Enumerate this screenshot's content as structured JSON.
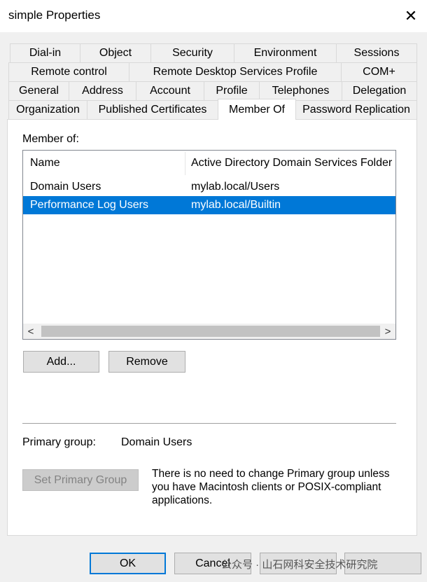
{
  "window": {
    "title": "simple Properties",
    "close_glyph": "✕"
  },
  "tabs": {
    "row1": [
      "Dial-in",
      "Object",
      "Security",
      "Environment",
      "Sessions"
    ],
    "row2": [
      "Remote control",
      "Remote Desktop Services Profile",
      "COM+"
    ],
    "row3": [
      "General",
      "Address",
      "Account",
      "Profile",
      "Telephones",
      "Delegation"
    ],
    "row4": [
      "Organization",
      "Published Certificates",
      "Member Of",
      "Password Replication"
    ],
    "active": "Member Of"
  },
  "member_of": {
    "label": "Member of:",
    "columns": [
      "Name",
      "Active Directory Domain Services Folder"
    ],
    "rows": [
      {
        "name": "Domain Users",
        "folder": "mylab.local/Users",
        "selected": false
      },
      {
        "name": "Performance Log Users",
        "folder": "mylab.local/Builtin",
        "selected": true
      }
    ],
    "scroll_left": "<",
    "scroll_right": ">"
  },
  "buttons": {
    "add": "Add...",
    "remove": "Remove",
    "set_primary": "Set Primary Group",
    "ok": "OK",
    "cancel": "Cancel"
  },
  "primary_group": {
    "label": "Primary group:",
    "value": "Domain Users",
    "note": "There is no need to change Primary group unless you have Macintosh clients or POSIX-compliant applications."
  },
  "watermark": "公众号 · 山石网科安全技术研究院",
  "colors": {
    "selection": "#0078d7",
    "dialog_bg": "#f0f0f0"
  }
}
